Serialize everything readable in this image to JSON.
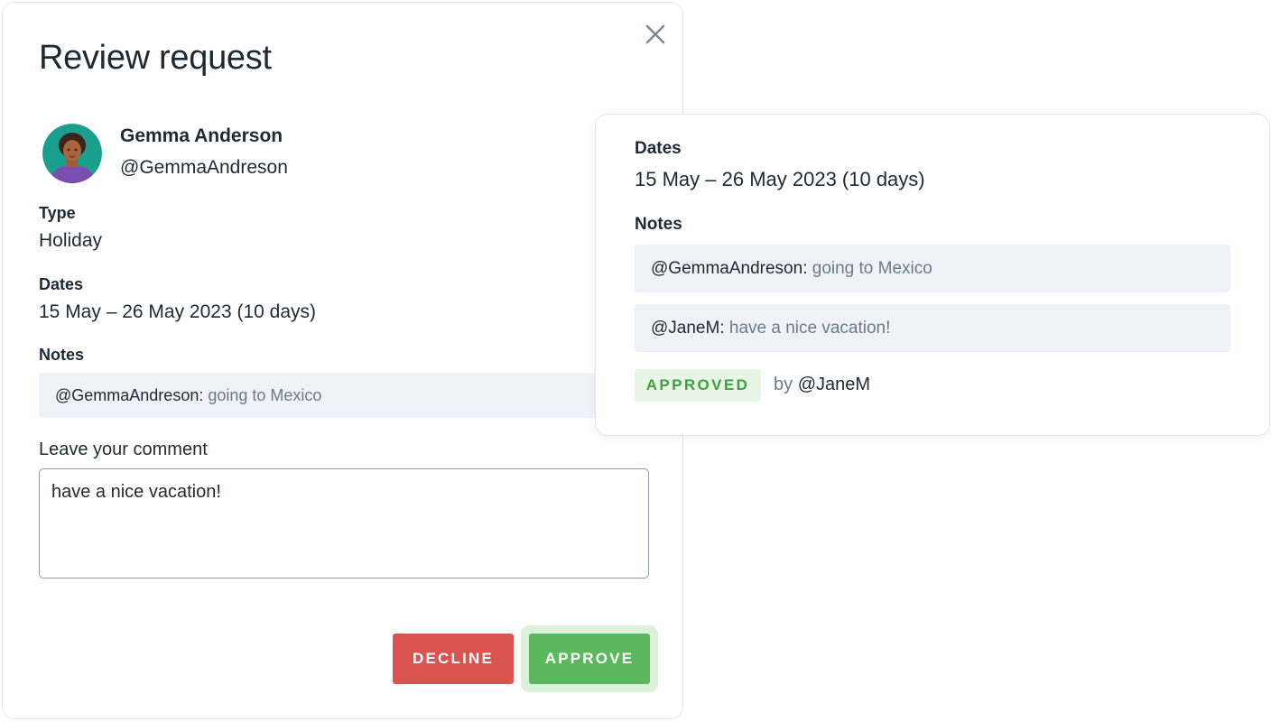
{
  "modal": {
    "title": "Review request",
    "user": {
      "name": "Gemma Anderson",
      "handle": "@GemmaAndreson"
    },
    "type": {
      "label": "Type",
      "value": "Holiday"
    },
    "dates": {
      "label": "Dates",
      "value": "15 May – 26 May 2023 (10 days)"
    },
    "notes": {
      "label": "Notes",
      "items": [
        {
          "author": "@GemmaAndreson:",
          "text": "going to Mexico"
        }
      ]
    },
    "comment": {
      "label": "Leave your comment",
      "value": "have a nice vacation!"
    },
    "buttons": {
      "decline": "DECLINE",
      "approve": "APPROVE"
    }
  },
  "popover": {
    "dates": {
      "label": "Dates",
      "value": "15 May – 26 May 2023 (10 days)"
    },
    "notes": {
      "label": "Notes",
      "items": [
        {
          "author": "@GemmaAndreson:",
          "text": "going to Mexico"
        },
        {
          "author": "@JaneM:",
          "text": "have a nice vacation!"
        }
      ]
    },
    "status": {
      "badge": "APPROVED",
      "by": "by",
      "user": "@JaneM"
    }
  },
  "colors": {
    "decline": "#d9534f",
    "approve": "#5cb85c",
    "approved_badge_bg": "#e6f5e5",
    "approved_badge_text": "#3fa03f",
    "note_bg": "#eff2f6"
  },
  "icons": {
    "close": "close-icon",
    "avatar": "avatar"
  }
}
